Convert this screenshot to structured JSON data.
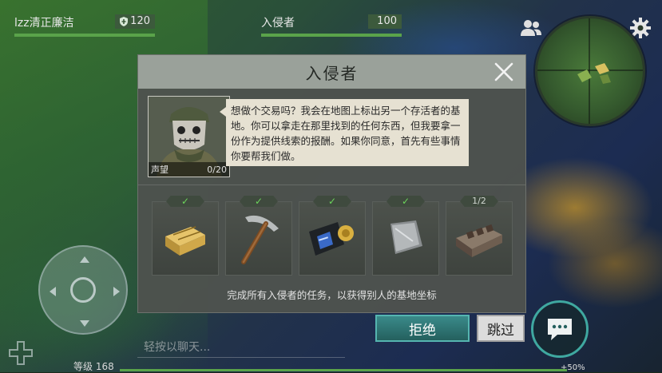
{
  "top": {
    "player_name": "lzz清正廉洁",
    "player_shield": "120",
    "enemy_name": "入侵者",
    "enemy_value": "100"
  },
  "dialog": {
    "title": "入侵者",
    "portrait_label": "声望",
    "portrait_progress": "0/20",
    "speech": "想做个交易吗？我会在地图上标出另一个存活者的基地。你可以拿走在那里找到的任何东西，但我要拿一份作为提供线索的报酬。如果你同意，首先有些事情你要帮我们做。",
    "tasks": [
      {
        "icon": "ammo-crate-icon",
        "status": "✓"
      },
      {
        "icon": "pickaxe-icon",
        "status": "✓"
      },
      {
        "icon": "police-badge-icon",
        "status": "✓"
      },
      {
        "icon": "metal-plate-icon",
        "status": "✓"
      },
      {
        "icon": "engine-part-icon",
        "status": "1/2"
      }
    ],
    "footer": "完成所有入侵者的任务，以获得别人的基地坐标"
  },
  "buttons": {
    "reject": "拒绝",
    "skip": "跳过"
  },
  "chat": {
    "placeholder": "轻按以聊天..."
  },
  "status": {
    "level": "等级 168",
    "xp_bonus": "+50%"
  },
  "colors": {
    "health_green": "#5aa34a",
    "accent_teal": "#3fa8a0",
    "check_green": "#6cd45c"
  }
}
